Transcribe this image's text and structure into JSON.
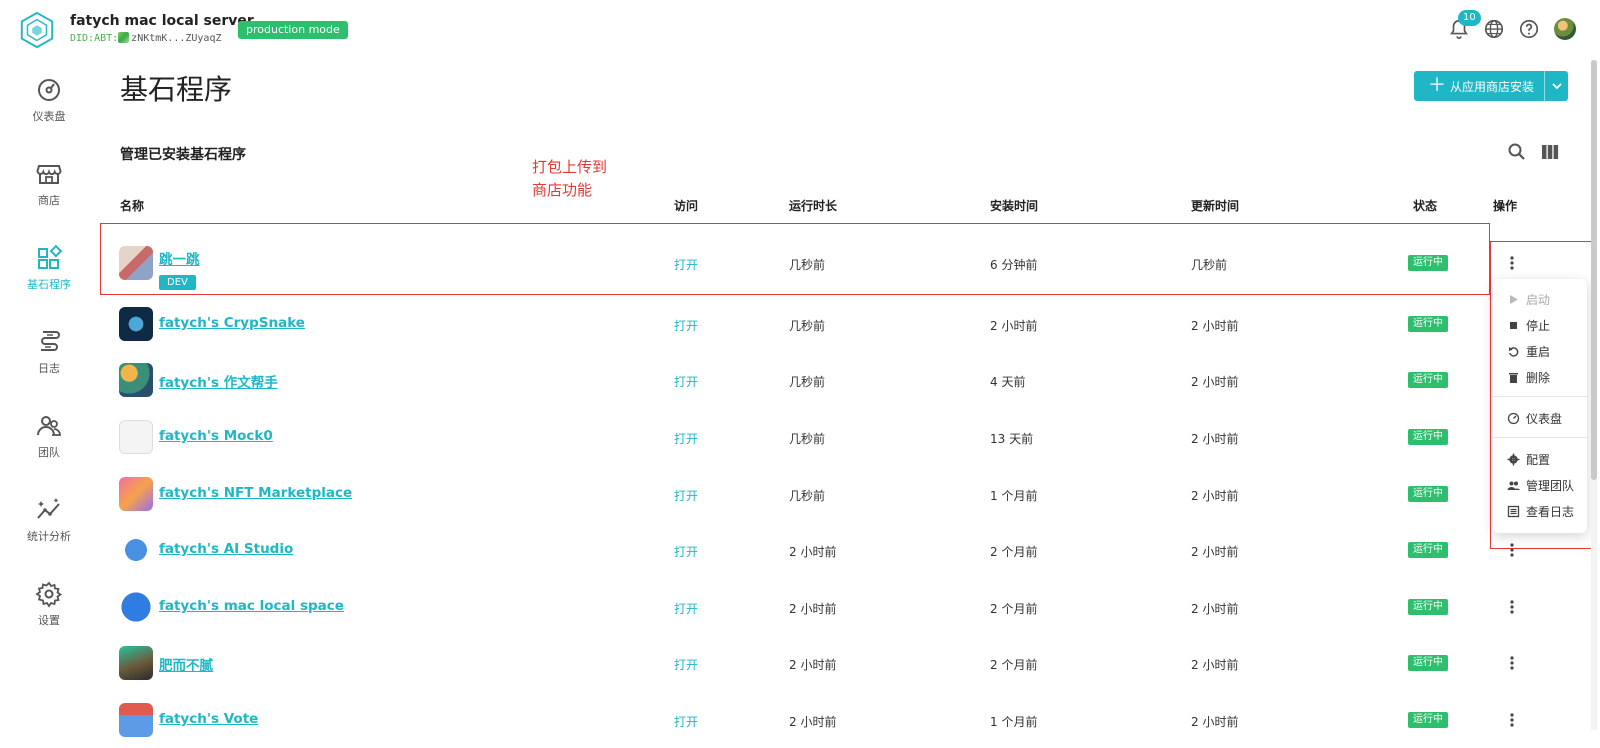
{
  "header": {
    "server_name": "fatych mac local server",
    "did_prefix": "DID:ABT:",
    "did_value": "zNKtmK...ZUyaqZ",
    "mode_badge": "production mode",
    "notification_count": "10"
  },
  "sidebar": {
    "items": [
      {
        "label": "仪表盘",
        "icon": "dashboard-icon"
      },
      {
        "label": "商店",
        "icon": "store-icon"
      },
      {
        "label": "基石程序",
        "icon": "blocklets-icon"
      },
      {
        "label": "日志",
        "icon": "logs-icon"
      },
      {
        "label": "团队",
        "icon": "team-icon"
      },
      {
        "label": "统计分析",
        "icon": "analytics-icon"
      },
      {
        "label": "设置",
        "icon": "settings-icon"
      }
    ],
    "active_index": 2
  },
  "main": {
    "title": "基石程序",
    "install_button": "从应用商店安装",
    "section_title": "管理已安装基石程序",
    "annotation_line1": "打包上传到",
    "annotation_line2": "商店功能",
    "columns": [
      "名称",
      "访问",
      "运行时长",
      "安装时间",
      "更新时间",
      "状态",
      "操作"
    ],
    "rows": [
      {
        "name": "跳一跳",
        "badge": "DEV",
        "access": "打开",
        "uptime": "几秒前",
        "installed": "6 分钟前",
        "updated": "几秒前",
        "status": "运行中"
      },
      {
        "name": "fatych's CrypSnake",
        "access": "打开",
        "uptime": "几秒前",
        "installed": "2 小时前",
        "updated": "2 小时前",
        "status": "运行中"
      },
      {
        "name": "fatych's 作文帮手",
        "access": "打开",
        "uptime": "几秒前",
        "installed": "4 天前",
        "updated": "2 小时前",
        "status": "运行中"
      },
      {
        "name": "fatych's Mock0",
        "access": "打开",
        "uptime": "几秒前",
        "installed": "13 天前",
        "updated": "2 小时前",
        "status": "运行中"
      },
      {
        "name": "fatych's NFT Marketplace",
        "access": "打开",
        "uptime": "几秒前",
        "installed": "1 个月前",
        "updated": "2 小时前",
        "status": "运行中"
      },
      {
        "name": "fatych's AI Studio",
        "access": "打开",
        "uptime": "2 小时前",
        "installed": "2 个月前",
        "updated": "2 小时前",
        "status": "运行中"
      },
      {
        "name": "fatych's mac local space",
        "access": "打开",
        "uptime": "2 小时前",
        "installed": "2 个月前",
        "updated": "2 小时前",
        "status": "运行中"
      },
      {
        "name": "肥而不腻",
        "access": "打开",
        "uptime": "2 小时前",
        "installed": "2 个月前",
        "updated": "2 小时前",
        "status": "运行中"
      },
      {
        "name": "fatych's Vote",
        "access": "打开",
        "uptime": "2 小时前",
        "installed": "1 个月前",
        "updated": "2 小时前",
        "status": "运行中"
      }
    ]
  },
  "action_menu": {
    "items": [
      {
        "label": "启动",
        "icon": "play-icon",
        "disabled": true
      },
      {
        "label": "停止",
        "icon": "stop-icon"
      },
      {
        "label": "重启",
        "icon": "restart-icon"
      },
      {
        "label": "删除",
        "icon": "trash-icon"
      },
      {
        "label": "仪表盘",
        "icon": "dashboard-icon"
      },
      {
        "label": "配置",
        "icon": "gear-icon"
      },
      {
        "label": "管理团队",
        "icon": "team-icon"
      },
      {
        "label": "查看日志",
        "icon": "log-icon"
      }
    ]
  },
  "colors": {
    "accent": "#1fb7c6",
    "status_green": "#2ebf6e",
    "annotation_red": "#e53935"
  }
}
